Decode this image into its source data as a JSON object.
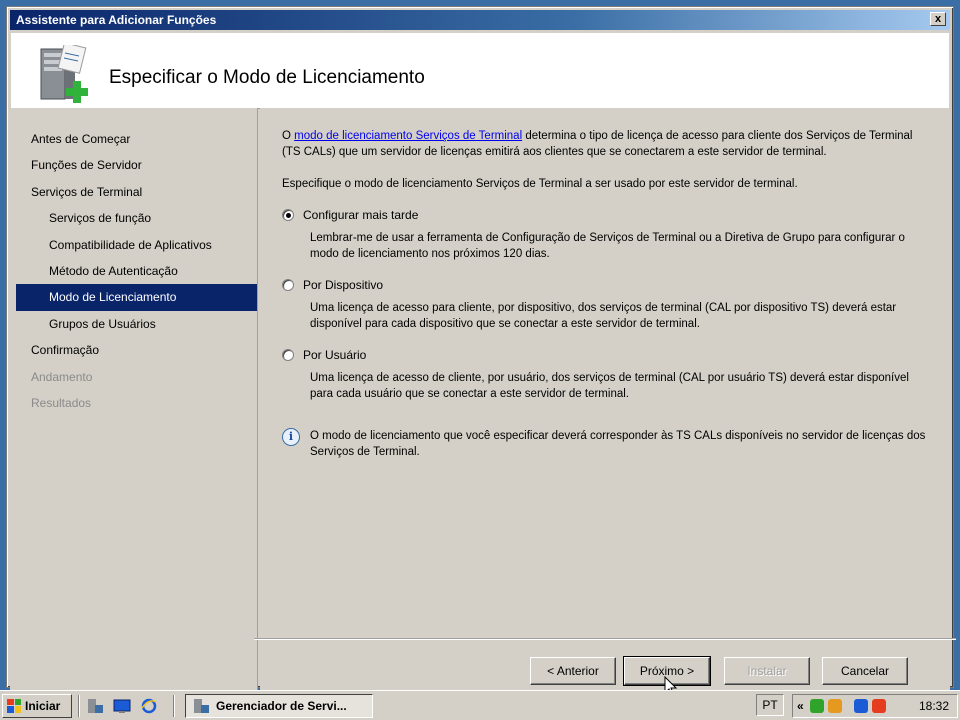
{
  "window": {
    "title": "Assistente para Adicionar Funções",
    "close_label": "x"
  },
  "header": {
    "title": "Especificar o Modo de Licenciamento"
  },
  "nav": {
    "items": [
      {
        "label": "Antes de Começar",
        "level": 0,
        "state": "normal"
      },
      {
        "label": "Funções de Servidor",
        "level": 0,
        "state": "normal"
      },
      {
        "label": "Serviços de Terminal",
        "level": 0,
        "state": "normal"
      },
      {
        "label": "Serviços de função",
        "level": 1,
        "state": "normal"
      },
      {
        "label": "Compatibilidade de Aplicativos",
        "level": 1,
        "state": "normal"
      },
      {
        "label": "Método de Autenticação",
        "level": 1,
        "state": "normal"
      },
      {
        "label": "Modo de Licenciamento",
        "level": 1,
        "state": "active"
      },
      {
        "label": "Grupos de Usuários",
        "level": 1,
        "state": "normal"
      },
      {
        "label": "Confirmação",
        "level": 0,
        "state": "normal"
      },
      {
        "label": "Andamento",
        "level": 0,
        "state": "disabled"
      },
      {
        "label": "Resultados",
        "level": 0,
        "state": "disabled"
      }
    ]
  },
  "content": {
    "intro_prefix": "O ",
    "intro_link": "modo de licenciamento Serviços de Terminal",
    "intro_suffix": " determina o tipo de licença de acesso para cliente dos Serviços de Terminal (TS CALs) que um servidor de licenças emitirá aos clientes que se conectarem a este servidor de terminal.",
    "instruction": "Especifique o modo de licenciamento Serviços de Terminal a ser usado por este servidor de terminal.",
    "options": [
      {
        "label": "Configurar mais tarde",
        "checked": true,
        "description": "Lembrar-me de usar a ferramenta de Configuração de Serviços de Terminal ou a Diretiva de Grupo para configurar o modo de licenciamento nos próximos 120 dias."
      },
      {
        "label": "Por Dispositivo",
        "checked": false,
        "description": "Uma licença de acesso para cliente, por dispositivo, dos serviços de terminal (CAL por dispositivo TS) deverá estar disponível para cada dispositivo que se conectar a este servidor de terminal."
      },
      {
        "label": "Por Usuário",
        "checked": false,
        "description": "Uma licença de acesso de cliente, por usuário, dos serviços de terminal (CAL por usuário TS) deverá estar disponível para cada usuário que se conectar a este servidor de terminal."
      }
    ],
    "info_text": "O modo de licenciamento que você especificar deverá corresponder às TS CALs disponíveis no servidor de licenças dos Serviços de Terminal."
  },
  "buttons": {
    "back": "< Anterior",
    "next": "Próximo >",
    "install": "Instalar",
    "cancel": "Cancelar"
  },
  "taskbar": {
    "start_label": "Iniciar",
    "task_label": "Gerenciador de Servi...",
    "language": "PT",
    "tray_chevron": "«",
    "clock": "18:32"
  },
  "icons": {
    "info": "info-icon",
    "server": "server-role-icon"
  },
  "colors": {
    "selection": "#0a246a",
    "link": "#0000ee",
    "dialog_bg": "#d4d0c8"
  }
}
